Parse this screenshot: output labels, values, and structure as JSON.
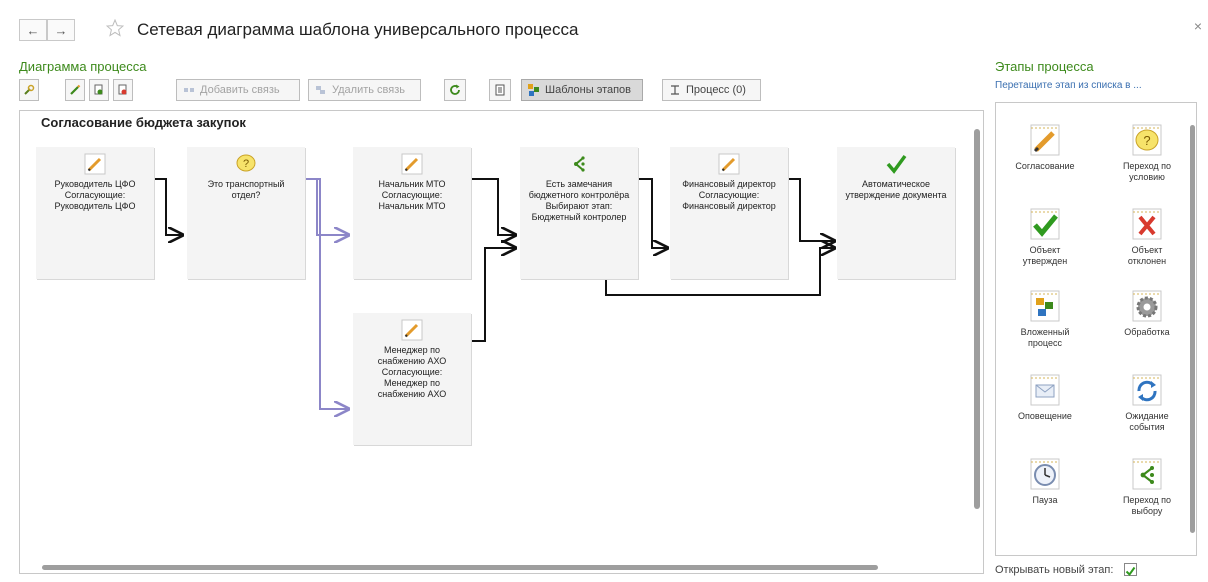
{
  "header": {
    "title": "Сетевая диаграмма шаблона универсального процесса",
    "close_glyph": "×",
    "back_glyph": "←",
    "forward_glyph": "→"
  },
  "diagram_section": {
    "title": "Диаграмма процесса"
  },
  "toolbar": {
    "add_link": "Добавить связь",
    "remove_link": "Удалить связь",
    "stage_templates": "Шаблоны этапов",
    "process": "Процесс (0)"
  },
  "process": {
    "name": "Согласование бюджета закупок",
    "nodes": [
      {
        "icon": "pencil-icon",
        "text": "Руководитель ЦФО\nСогласующие:\nРуководитель ЦФО"
      },
      {
        "icon": "question-icon",
        "text": "Это транспортный\nотдел?"
      },
      {
        "icon": "pencil-icon",
        "text": "Начальник МТО\nСогласующие:\nНачальник МТО"
      },
      {
        "icon": "fork-icon",
        "text": "Есть замечания\nбюджетного контролёра\nВыбирают этап:\nБюджетный контролер"
      },
      {
        "icon": "pencil-icon",
        "text": "Финансовый директор\nСогласующие:\nФинансовый директор"
      },
      {
        "icon": "checkmark-icon",
        "text": "Автоматическое\nутверждение документа"
      },
      {
        "icon": "pencil-icon",
        "text": "Менеджер по\nснабжению АХО\nСогласующие:\nМенеджер по\nснабжению АХО"
      }
    ]
  },
  "stages_panel": {
    "title": "Этапы процесса",
    "hint": "Перетащите этап из списка в ...",
    "items": [
      {
        "label": "Согласование",
        "icon": "pencil-icon"
      },
      {
        "label": "Переход по\nусловию",
        "icon": "question-icon"
      },
      {
        "label": "Объект\nутвержден",
        "icon": "checkmark-icon"
      },
      {
        "label": "Объект\nотклонен",
        "icon": "cross-icon"
      },
      {
        "label": "Вложенный\nпроцесс",
        "icon": "nested-process-icon"
      },
      {
        "label": "Обработка",
        "icon": "gear-icon"
      },
      {
        "label": "Оповещение",
        "icon": "envelope-icon"
      },
      {
        "label": "Ожидание\nсобытия",
        "icon": "refresh-arrows-icon"
      },
      {
        "label": "Пауза",
        "icon": "clock-icon"
      },
      {
        "label": "Переход по\nвыбору",
        "icon": "fork-icon"
      }
    ]
  },
  "footer": {
    "open_new_stage_label": "Открывать новый этап:",
    "open_new_stage_checked": true
  },
  "colors": {
    "accent_green": "#3d8a1c",
    "link_blue": "#3a6fb0",
    "connector_purple": "#8c86c8"
  }
}
